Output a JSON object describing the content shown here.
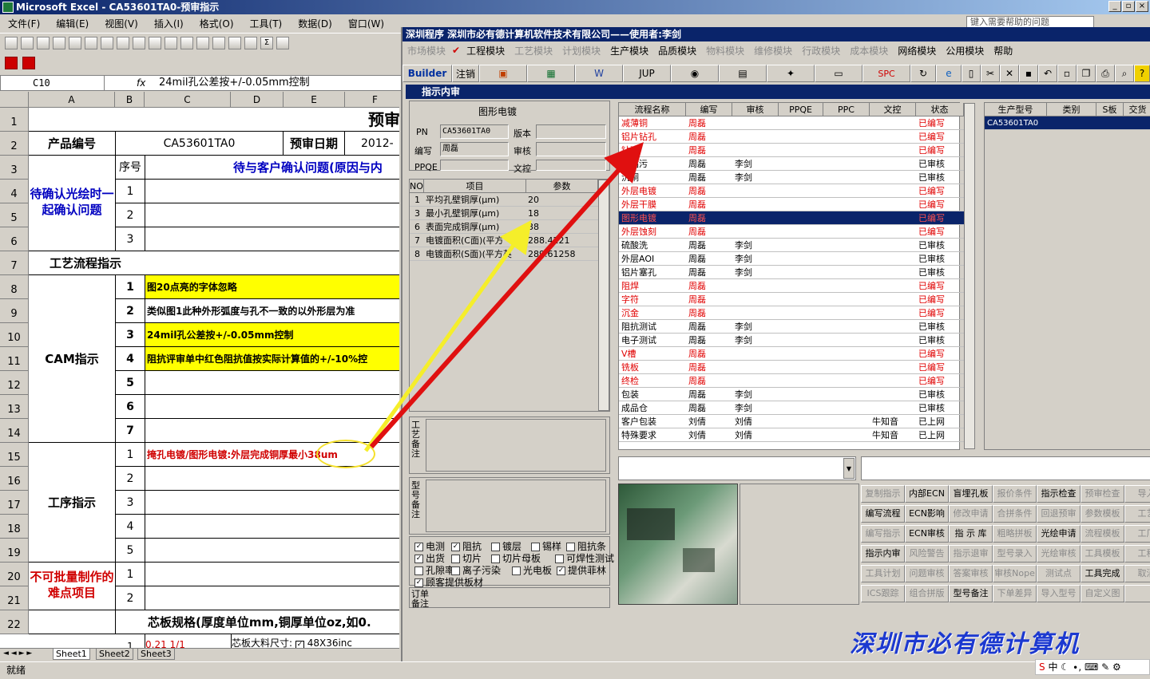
{
  "excel": {
    "title": "Microsoft Excel - CA53601TA0-预审指示",
    "menu": [
      "文件(F)",
      "编辑(E)",
      "视图(V)",
      "插入(I)",
      "格式(O)",
      "工具(T)",
      "数据(D)",
      "窗口(W)",
      "帮助"
    ],
    "help_prompt": "键入需要帮助的问题",
    "namebox": "C10",
    "fx": "fx",
    "formula": "24mil孔公差按+/-0.05mm控制",
    "col_headers": [
      "A",
      "B",
      "C",
      "D",
      "E",
      "F"
    ],
    "row_headers": [
      "1",
      "2",
      "3",
      "4",
      "5",
      "6",
      "7",
      "8",
      "9",
      "10",
      "11",
      "12",
      "13",
      "14",
      "15",
      "16",
      "17",
      "18",
      "19",
      "20",
      "21",
      "22"
    ],
    "title_cell": "预审",
    "product_label": "产品编号",
    "product_value": "CA53601TA0",
    "date_label": "预审日期",
    "date_value": "2012-",
    "seq_label": "序号",
    "confirm_header": "待与客户确认问题(原因与内",
    "confirm_group": "待确认光绘时一起确认问题",
    "process_title": "工艺流程指示",
    "cam_group": "CAM指示",
    "cam_items": [
      "图20点亮的字体忽略",
      "类似图1此种外形弧度与孔不一致的以外形层为准",
      "24mil孔公差按+/-0.05mm控制",
      "阻抗评审单中红色阻抗值按实际计算值的+/-10%控"
    ],
    "step_group": "工序指示",
    "step_item": "掩孔电镀/图形电镀:外层完成铜厚最小38um",
    "difficult_group": "不可批量制作的难点项目",
    "core_spec": "芯板规格(厚度单位mm,铜厚单位oz,如0.",
    "core_row": "0.21 1/1",
    "core_size": "芯板大料尺寸:",
    "core_size_val": "48X36inc",
    "tabs": [
      "Sheet1",
      "Sheet2",
      "Sheet3"
    ],
    "status": "就绪"
  },
  "app": {
    "title": "深圳程序   深圳市必有德计算机软件技术有限公司——使用者:李剑",
    "menu": [
      {
        "label": "市场模块",
        "enabled": false
      },
      {
        "label": "工程模块",
        "enabled": true
      },
      {
        "label": "工艺模块",
        "enabled": false
      },
      {
        "label": "计划模块",
        "enabled": false
      },
      {
        "label": "生产模块",
        "enabled": true
      },
      {
        "label": "品质模块",
        "enabled": true
      },
      {
        "label": "物料模块",
        "enabled": false
      },
      {
        "label": "维修模块",
        "enabled": false
      },
      {
        "label": "行政模块",
        "enabled": false
      },
      {
        "label": "成本模块",
        "enabled": false
      },
      {
        "label": "网络模块",
        "enabled": true
      },
      {
        "label": "公用模块",
        "enabled": true
      },
      {
        "label": "帮助",
        "enabled": true
      }
    ],
    "toolbar": {
      "builder": "Builder",
      "logout": "注销",
      "jup": "JUP",
      "spc": "SPC"
    },
    "window_title": "指示内审",
    "group_title": "图形电镀",
    "form": {
      "pn_label": "PN",
      "pn_value": "CA53601TA0",
      "version_label": "版本",
      "author_label": "编写",
      "author_value": "周磊",
      "review_label": "审核",
      "ppqe_label": "PPQE",
      "doc_label": "文控"
    },
    "param_table": {
      "headers": [
        "NO",
        "项目",
        "参数"
      ],
      "rows": [
        {
          "no": "1",
          "item": "平均孔壁铜厚(μm)",
          "value": "20"
        },
        {
          "no": "3",
          "item": "最小孔壁铜厚(μm)",
          "value": "18"
        },
        {
          "no": "6",
          "item": "表面完成铜厚(μm)",
          "value": "38"
        },
        {
          "no": "7",
          "item": "电镀面积(C面)(平方",
          "value": "288.4221"
        },
        {
          "no": "8",
          "item": "电镀面积(S面)(平方英",
          "value": "289.61258"
        }
      ]
    },
    "side_labels": {
      "process_note": "工艺备注",
      "model_note": "型号备注",
      "order_note": "订单备注"
    },
    "checks": [
      {
        "label": "电测",
        "checked": true
      },
      {
        "label": "阻抗",
        "checked": true
      },
      {
        "label": "镀层",
        "checked": false
      },
      {
        "label": "锡样",
        "checked": false
      },
      {
        "label": "阻抗条",
        "checked": false
      },
      {
        "label": "出货",
        "checked": true
      },
      {
        "label": "切片",
        "checked": false
      },
      {
        "label": "切片母板",
        "checked": false
      },
      {
        "label": "可焊性测试",
        "checked": false
      },
      {
        "label": "孔隙率",
        "checked": false
      },
      {
        "label": "离子污染",
        "checked": false
      },
      {
        "label": "光电板",
        "checked": false
      },
      {
        "label": "提供菲林",
        "checked": true
      },
      {
        "label": "顾客提供板材",
        "checked": true
      }
    ],
    "flow_table": {
      "headers": [
        "流程名称",
        "编写",
        "审核",
        "PPQE",
        "PPC",
        "文控",
        "状态"
      ],
      "rows": [
        {
          "name": "减薄铜",
          "writer": "周磊",
          "reviewer": "",
          "doc": "",
          "status": "已编写",
          "red": true
        },
        {
          "name": "铝片钻孔",
          "writer": "周磊",
          "reviewer": "",
          "doc": "",
          "status": "已编写",
          "red": true
        },
        {
          "name": "钻孔",
          "writer": "周磊",
          "reviewer": "",
          "doc": "",
          "status": "已编写",
          "red": true
        },
        {
          "name": "去钻污",
          "writer": "周磊",
          "reviewer": "李剑",
          "doc": "",
          "status": "已审核",
          "red": false
        },
        {
          "name": "沉铜",
          "writer": "周磊",
          "reviewer": "李剑",
          "doc": "",
          "status": "已审核",
          "red": false
        },
        {
          "name": "外层电镀",
          "writer": "周磊",
          "reviewer": "",
          "doc": "",
          "status": "已编写",
          "red": true
        },
        {
          "name": "外层干膜",
          "writer": "周磊",
          "reviewer": "",
          "doc": "",
          "status": "已编写",
          "red": true
        },
        {
          "name": "图形电镀",
          "writer": "周磊",
          "reviewer": "",
          "doc": "",
          "status": "已编写",
          "red": true,
          "selected": true
        },
        {
          "name": "外层蚀刻",
          "writer": "周磊",
          "reviewer": "",
          "doc": "",
          "status": "已编写",
          "red": true
        },
        {
          "name": "硫酸洗",
          "writer": "周磊",
          "reviewer": "李剑",
          "doc": "",
          "status": "已审核",
          "red": false
        },
        {
          "name": "外层AOI",
          "writer": "周磊",
          "reviewer": "李剑",
          "doc": "",
          "status": "已审核",
          "red": false
        },
        {
          "name": "铝片塞孔",
          "writer": "周磊",
          "reviewer": "李剑",
          "doc": "",
          "status": "已审核",
          "red": false
        },
        {
          "name": "阻焊",
          "writer": "周磊",
          "reviewer": "",
          "doc": "",
          "status": "已编写",
          "red": true
        },
        {
          "name": "字符",
          "writer": "周磊",
          "reviewer": "",
          "doc": "",
          "status": "已编写",
          "red": true
        },
        {
          "name": "沉金",
          "writer": "周磊",
          "reviewer": "",
          "doc": "",
          "status": "已编写",
          "red": true
        },
        {
          "name": "阻抗测试",
          "writer": "周磊",
          "reviewer": "李剑",
          "doc": "",
          "status": "已审核",
          "red": false
        },
        {
          "name": "电子测试",
          "writer": "周磊",
          "reviewer": "李剑",
          "doc": "",
          "status": "已审核",
          "red": false
        },
        {
          "name": "V槽",
          "writer": "周磊",
          "reviewer": "",
          "doc": "",
          "status": "已编写",
          "red": true
        },
        {
          "name": "铣板",
          "writer": "周磊",
          "reviewer": "",
          "doc": "",
          "status": "已编写",
          "red": true
        },
        {
          "name": "终检",
          "writer": "周磊",
          "reviewer": "",
          "doc": "",
          "status": "已编写",
          "red": true
        },
        {
          "name": "包装",
          "writer": "周磊",
          "reviewer": "李剑",
          "doc": "",
          "status": "已审核",
          "red": false
        },
        {
          "name": "成品仓",
          "writer": "周磊",
          "reviewer": "李剑",
          "doc": "",
          "status": "已审核",
          "red": false
        },
        {
          "name": "客户包装",
          "writer": "刘倩",
          "reviewer": "刘倩",
          "doc": "牛知音",
          "status": "已上网",
          "red": false
        },
        {
          "name": "特殊要求",
          "writer": "刘倩",
          "reviewer": "刘倩",
          "doc": "牛知音",
          "status": "已上网",
          "red": false
        }
      ]
    },
    "model_table": {
      "headers": [
        "生产型号",
        "类别",
        "S板",
        "交货"
      ],
      "rows": [
        {
          "model": "CA53601TA0"
        }
      ]
    },
    "buttons": [
      {
        "label": "复制指示",
        "enabled": false
      },
      {
        "label": "内部ECN",
        "enabled": true
      },
      {
        "label": "盲埋孔板",
        "enabled": true
      },
      {
        "label": "报价条件",
        "enabled": false
      },
      {
        "label": "指示检查",
        "enabled": true
      },
      {
        "label": "预审检查",
        "enabled": false
      },
      {
        "label": "导入",
        "enabled": false
      },
      {
        "label": "编写流程",
        "enabled": true
      },
      {
        "label": "ECN影响",
        "enabled": true
      },
      {
        "label": "修改申请",
        "enabled": false
      },
      {
        "label": "合拼条件",
        "enabled": false
      },
      {
        "label": "回退预审",
        "enabled": false
      },
      {
        "label": "参数模板",
        "enabled": false
      },
      {
        "label": "工艺",
        "enabled": false
      },
      {
        "label": "编写指示",
        "enabled": false
      },
      {
        "label": "ECN审核",
        "enabled": true
      },
      {
        "label": "指 示 库",
        "enabled": true
      },
      {
        "label": "粗略拼板",
        "enabled": false
      },
      {
        "label": "光绘申请",
        "enabled": true
      },
      {
        "label": "流程模板",
        "enabled": false
      },
      {
        "label": "工厂",
        "enabled": false
      },
      {
        "label": "指示内审",
        "enabled": true
      },
      {
        "label": "风险警告",
        "enabled": false
      },
      {
        "label": "指示退审",
        "enabled": false
      },
      {
        "label": "型号录入",
        "enabled": false
      },
      {
        "label": "光绘审核",
        "enabled": false
      },
      {
        "label": "工具模板",
        "enabled": false
      },
      {
        "label": "工程",
        "enabled": false
      },
      {
        "label": "工具计划",
        "enabled": false
      },
      {
        "label": "问题审核",
        "enabled": false
      },
      {
        "label": "答案审核",
        "enabled": false
      },
      {
        "label": "审核Nope",
        "enabled": false
      },
      {
        "label": "测试点",
        "enabled": false
      },
      {
        "label": "工具完成",
        "enabled": true
      },
      {
        "label": "取消",
        "enabled": false
      },
      {
        "label": "ICS跟踪",
        "enabled": false
      },
      {
        "label": "组合拼版",
        "enabled": false
      },
      {
        "label": "型号备注",
        "enabled": true
      },
      {
        "label": "下单差异",
        "enabled": false
      },
      {
        "label": "导入型号",
        "enabled": false
      },
      {
        "label": "自定义图",
        "enabled": false
      },
      {
        "label": "",
        "enabled": false
      }
    ],
    "banner": "深圳市必有德计算机"
  }
}
